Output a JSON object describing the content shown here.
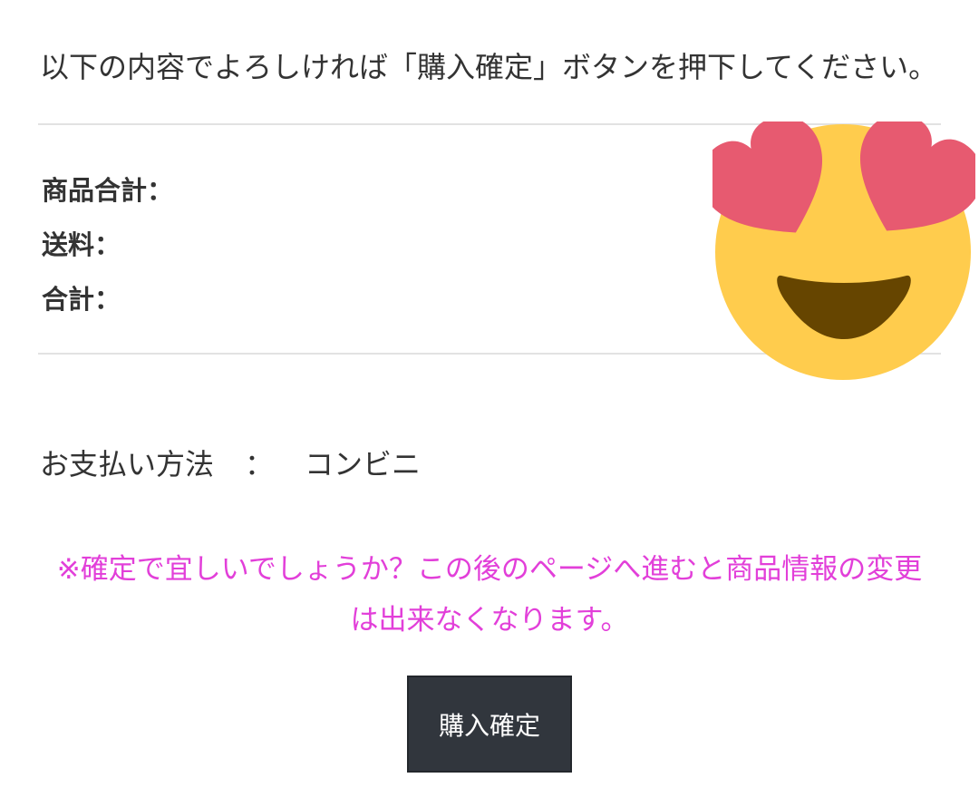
{
  "instruction": "以下の内容でよろしければ「購入確定」ボタンを押下してください。",
  "summary": {
    "rows": [
      {
        "label": "商品合計：",
        "value": ""
      },
      {
        "label": "送料：",
        "value": ""
      },
      {
        "label": "合計：",
        "value": ""
      }
    ]
  },
  "payment": {
    "label": "お支払い方法",
    "separator": "：",
    "value": "コンビニ"
  },
  "notice": {
    "line1": "※確定で宜しいでしょうか？この後のページへ進むと商品情報の変更",
    "line2": "は出来なくなります。"
  },
  "confirm_button": {
    "label": "購入確定"
  },
  "sticker": {
    "icon": "heart-eyes-emoji-icon"
  },
  "colors": {
    "notice": "#e23fd9",
    "button_bg": "#31363d",
    "emoji_face": "#ffcc4d",
    "emoji_hearts": "#e75a70",
    "emoji_mouth": "#664500"
  }
}
